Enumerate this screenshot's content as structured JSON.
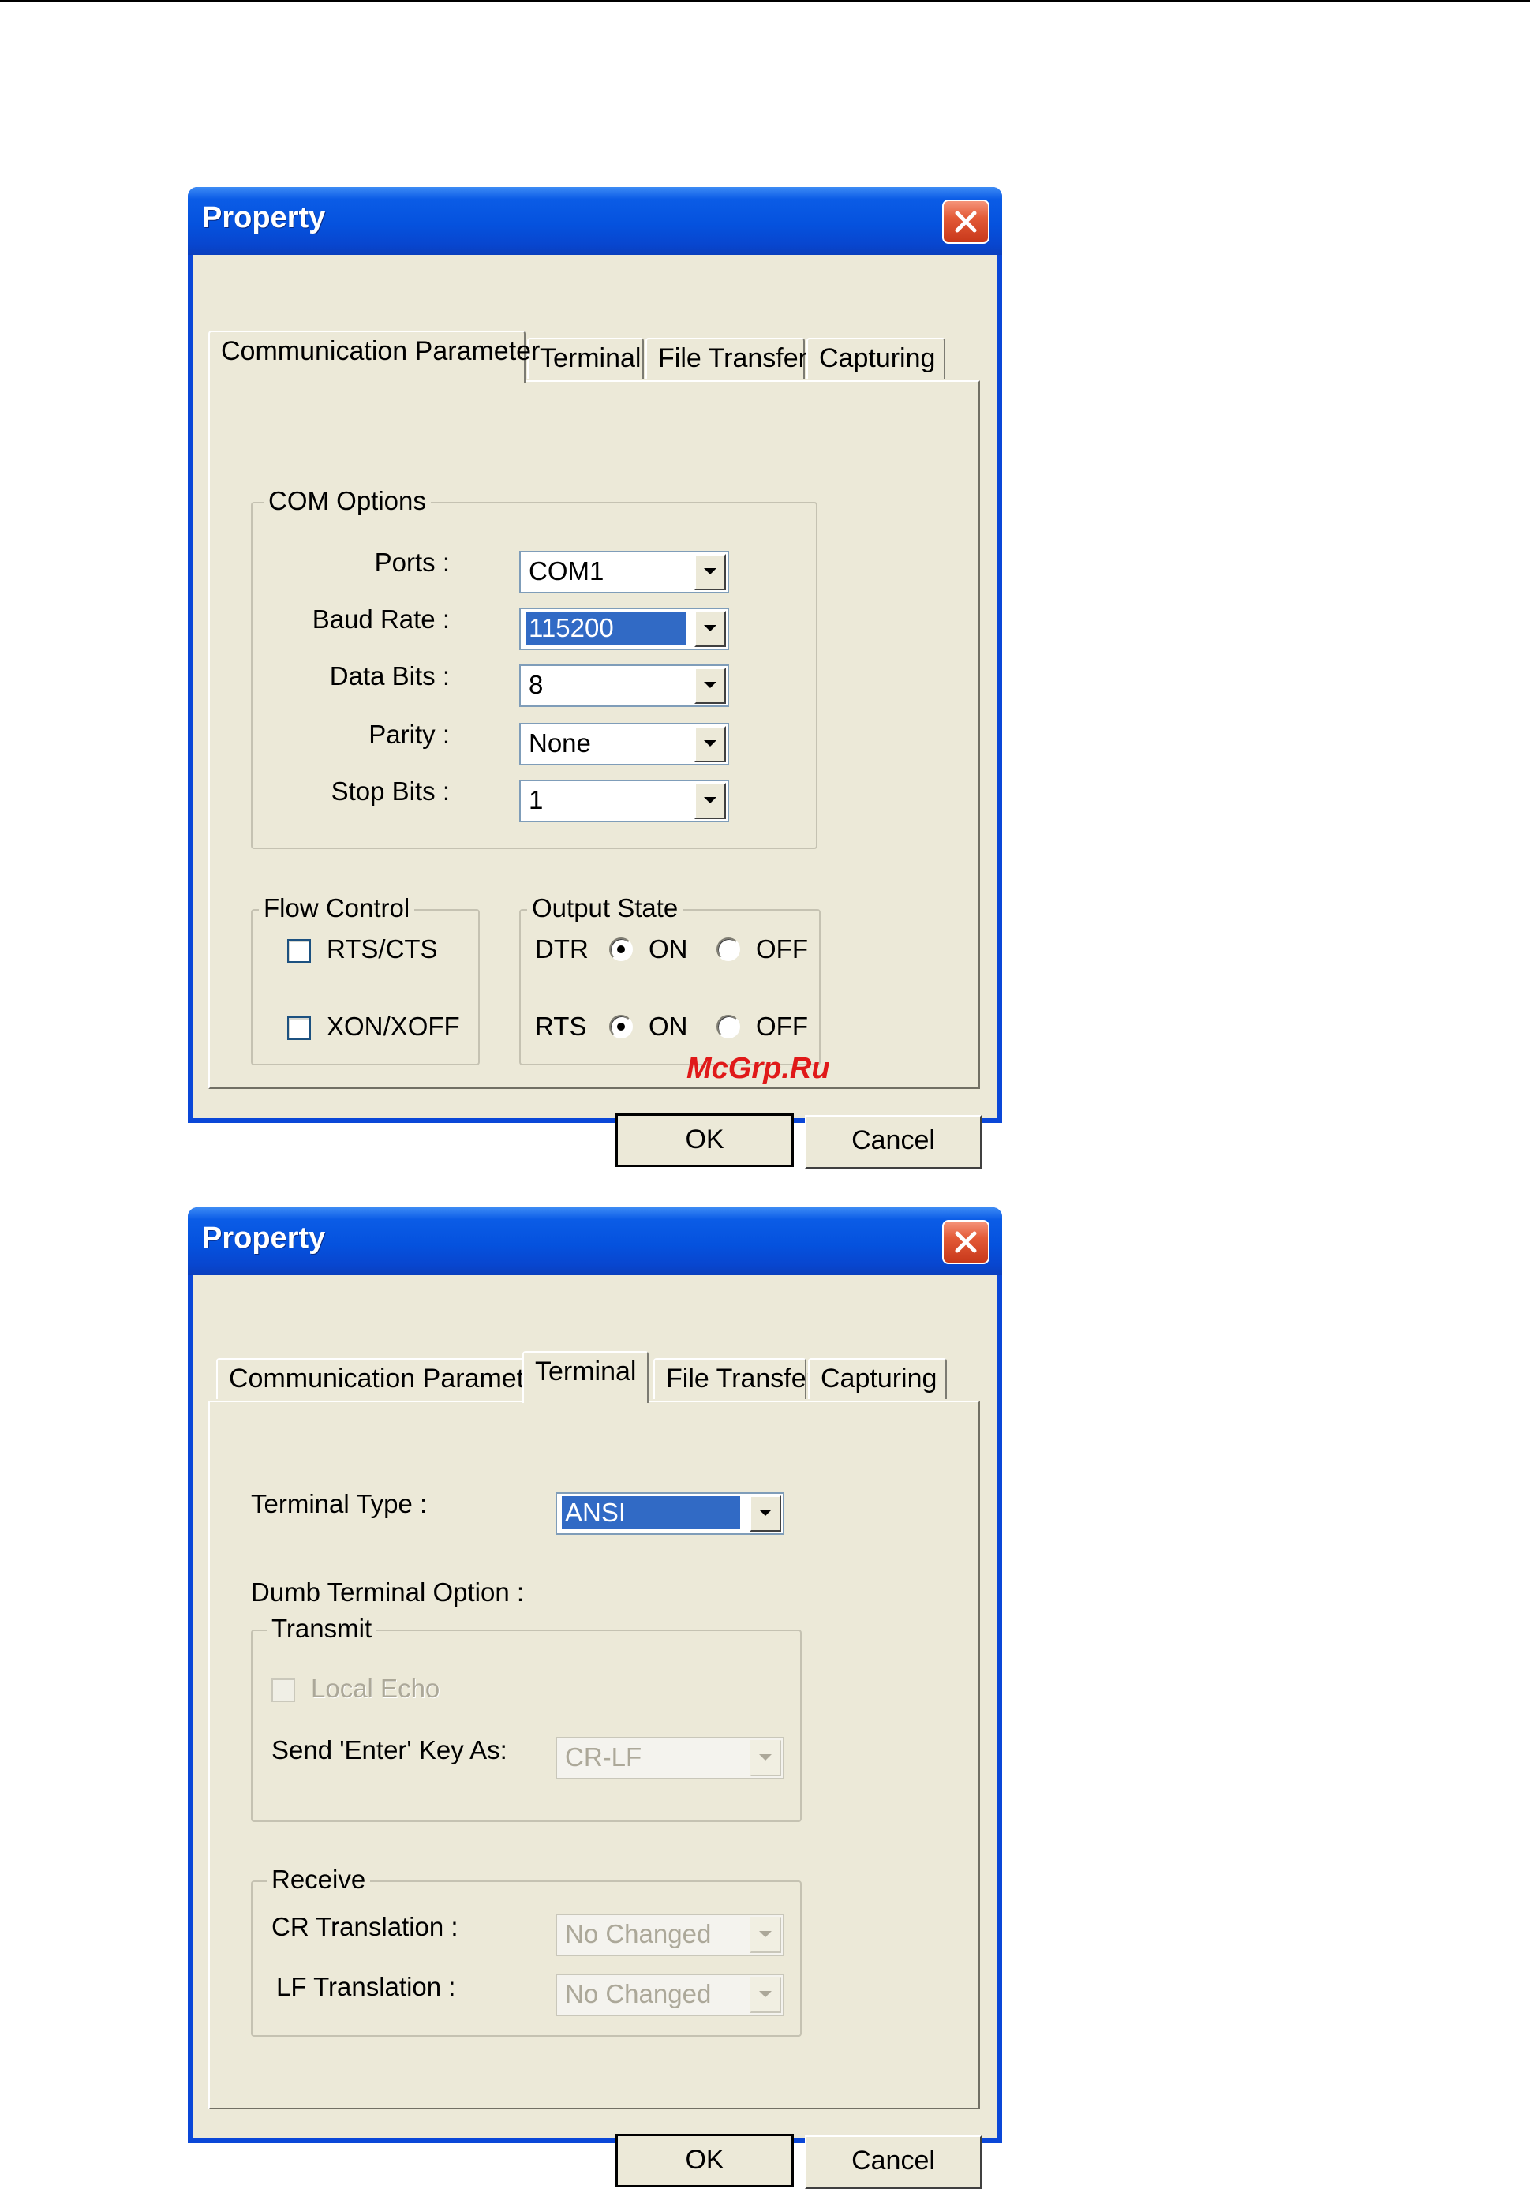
{
  "watermark": "McGrp.Ru",
  "dialog1": {
    "title": "Property",
    "tabs": [
      "Communication Parameter",
      "Terminal",
      "File Transfer",
      "Capturing"
    ],
    "active_tab": "Communication Parameter",
    "com_options": {
      "label": "COM Options",
      "fields": [
        {
          "label": "Ports :",
          "value": "COM1"
        },
        {
          "label": "Baud Rate :",
          "value": "115200"
        },
        {
          "label": "Data Bits :",
          "value": "8"
        },
        {
          "label": "Parity :",
          "value": "None"
        },
        {
          "label": "Stop Bits :",
          "value": "1"
        }
      ]
    },
    "flow_control": {
      "label": "Flow Control",
      "options": [
        {
          "label": "RTS/CTS",
          "checked": false
        },
        {
          "label": "XON/XOFF",
          "checked": false
        }
      ]
    },
    "output_state": {
      "label": "Output State",
      "rows": [
        {
          "name": "DTR",
          "on": "ON",
          "off": "OFF",
          "selected": "ON"
        },
        {
          "name": "RTS",
          "on": "ON",
          "off": "OFF",
          "selected": "ON"
        }
      ]
    },
    "ok_label": "OK",
    "cancel_label": "Cancel"
  },
  "dialog2": {
    "title": "Property",
    "tabs": [
      "Communication Parameter",
      "Terminal",
      "File Transfer",
      "Capturing"
    ],
    "active_tab": "Terminal",
    "terminal_type_label": "Terminal Type :",
    "terminal_type_value": "ANSI",
    "dumb_terminal_label": "Dumb Terminal Option :",
    "transmit": {
      "label": "Transmit",
      "local_echo_label": "Local Echo",
      "send_enter_label": "Send 'Enter' Key  As:",
      "send_enter_value": "CR-LF"
    },
    "receive": {
      "label": "Receive",
      "cr_label": "CR Translation :",
      "cr_value": "No Changed",
      "lf_label": "LF Translation :",
      "lf_value": "No Changed"
    },
    "ok_label": "OK",
    "cancel_label": "Cancel"
  }
}
